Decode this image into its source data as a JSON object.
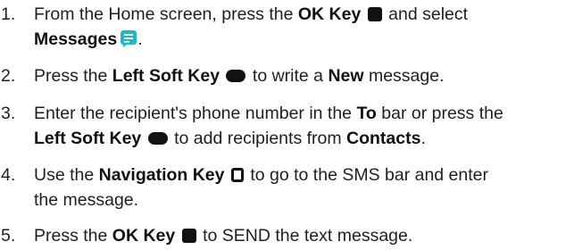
{
  "steps": [
    {
      "number": "1.",
      "parts": {
        "a": "From the Home screen, press the ",
        "b_ok": "OK Key",
        "c": " and select",
        "d_messages": "Messages",
        "e": "."
      },
      "icons": [
        "ok-key-icon",
        "messages-app-icon"
      ]
    },
    {
      "number": "2.",
      "parts": {
        "a": "Press the ",
        "b_lsk": "Left Soft Key",
        "c": " to write a ",
        "d_new": "New",
        "e": " message."
      },
      "icons": [
        "left-soft-key-icon"
      ]
    },
    {
      "number": "3.",
      "parts": {
        "a": "Enter the recipient's phone number in the ",
        "b_to": "To",
        "c": " bar or press the",
        "d_lsk": "Left Soft Key",
        "e": " to add recipients from ",
        "f_contacts": "Contacts",
        "g": "."
      },
      "icons": [
        "left-soft-key-icon"
      ]
    },
    {
      "number": "4.",
      "parts": {
        "a": "Use the ",
        "b_nav": "Navigation Key",
        "c": " to go to the SMS bar and enter",
        "d": "the message."
      },
      "icons": [
        "navigation-key-icon"
      ]
    },
    {
      "number": "5.",
      "parts": {
        "a": "Press the ",
        "b_ok": "OK Key",
        "c": " to SEND the text message."
      },
      "icons": [
        "ok-key-icon"
      ]
    }
  ],
  "colors": {
    "text": "#1f1f1f",
    "key_icon": "#111111",
    "messages_icon": "#22b7c4"
  }
}
